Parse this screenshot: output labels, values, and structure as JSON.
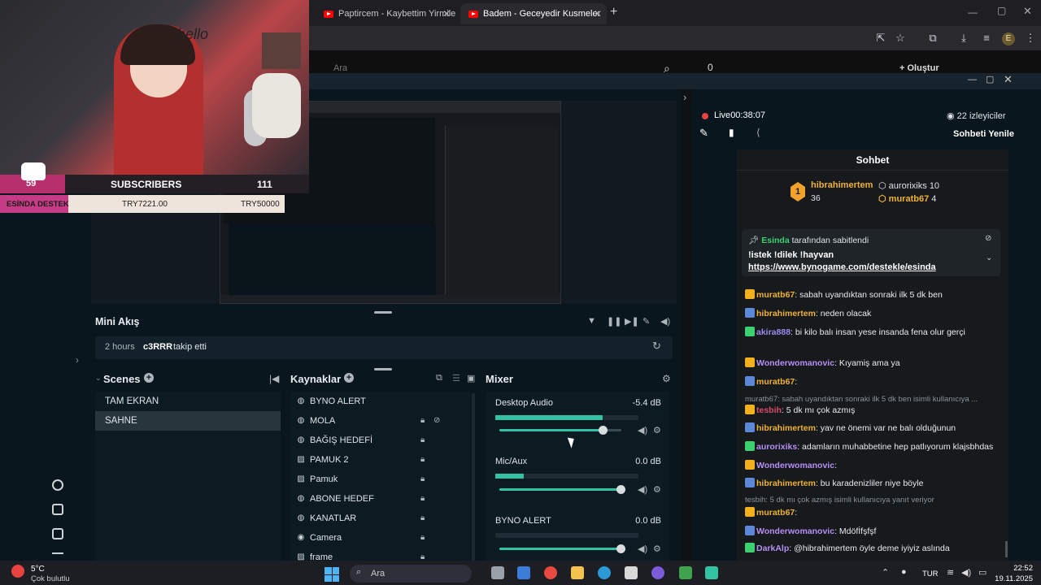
{
  "browser": {
    "tabs": [
      {
        "title": "Paptircem - Kaybettim Yirmiler"
      },
      {
        "title": "Badem - Geceyedir Kusmeler"
      }
    ],
    "new_tab": "+",
    "profile": "E"
  },
  "youtube": {
    "search_placeholder": "Ara",
    "notif_count": "0",
    "create_label": "Oluştur"
  },
  "overlay": {
    "subs_count_left": "59",
    "subs_label": "SUBSCRIBERS",
    "subs_count_right": "111",
    "donate_label": "ESİNDA DESTEK",
    "donate_current": "TRY7221.00",
    "donate_goal": "TRY50000"
  },
  "mini_feed": {
    "title": "Mini Akış",
    "event_time": "2 hours",
    "event_user": "c3RRR",
    "event_action": "takip etti"
  },
  "scenes": {
    "title": "Scenes",
    "items": [
      {
        "label": "TAM EKRAN",
        "selected": false
      },
      {
        "label": "SAHNE",
        "selected": true
      }
    ]
  },
  "sources": {
    "title": "Kaynaklar",
    "items": [
      {
        "label": "BYNO ALERT",
        "icon": "globe-icon"
      },
      {
        "label": "MOLA",
        "icon": "globe-icon"
      },
      {
        "label": "BAĞIŞ HEDEFİ",
        "icon": "globe-icon"
      },
      {
        "label": "PAMUK 2",
        "icon": "image-icon"
      },
      {
        "label": "Pamuk",
        "icon": "image-icon"
      },
      {
        "label": "ABONE HEDEF",
        "icon": "globe-icon"
      },
      {
        "label": "KANATLAR",
        "icon": "globe-icon"
      },
      {
        "label": "Camera",
        "icon": "camera-icon"
      },
      {
        "label": "frame",
        "icon": "image-icon"
      }
    ]
  },
  "mixer": {
    "title": "Mixer",
    "channels": [
      {
        "label": "Desktop Audio",
        "db": "-5.4 dB",
        "level": 0.75,
        "volume": 0.85
      },
      {
        "label": "Mic/Aux",
        "db": "0.0 dB",
        "level": 0.2,
        "volume": 1.0
      },
      {
        "label": "BYNO ALERT",
        "db": "0.0 dB",
        "level": 0.0,
        "volume": 1.0
      }
    ]
  },
  "live": {
    "status": "Live",
    "time": "00:38:07",
    "viewers": "22 izleyiciler",
    "refresh_chat": "Sohbeti Yenile"
  },
  "chat": {
    "title": "Sohbet",
    "top_user": "hibrahimertem",
    "top_user_score": "36",
    "top2_user": "aurorixiks",
    "top2_score": "10",
    "top3_user": "muratb67",
    "top3_score": "4",
    "pinned_by": "Esinda",
    "pinned_suffix": "tarafından sabitlendi",
    "pinned_text": "!istek !dilek !hayvan",
    "pinned_link": "https://www.bynogame.com/destekle/esinda",
    "messages": [
      {
        "user": "muratb67",
        "text": ": sabah uyandıktan sonraki ilk 5 dk ben",
        "color": "#f0b132"
      },
      {
        "user": "hibrahimertem",
        "text": ": neden olacak",
        "color": "#f0b132"
      },
      {
        "user": "akira888",
        "text": ": bi kilo balı insan yese insanda fena olur gerçi",
        "color": "#9b8cf0"
      },
      {
        "user": "Wonderwomanovic",
        "text": ": Kıyamiş ama ya",
        "color": "#b78ef5"
      },
      {
        "user": "muratb67",
        "text": ":",
        "color": "#f0b132"
      },
      {
        "reply": "muratb67: sabah uyandıktan sonraki ilk 5 dk ben isimli kullanıcıya ..."
      },
      {
        "user": "tesbih",
        "text": ": 5 dk mı çok azmış",
        "color": "#d84b6a"
      },
      {
        "user": "hibrahimertem",
        "text": ": yav ne önemi var ne balı olduğunun",
        "color": "#f0b132"
      },
      {
        "user": "aurorixiks",
        "text": ": adamların muhabbetine hep patlıyorum klajsbhdas",
        "color": "#b78ef5"
      },
      {
        "user": "Wonderwomanovic",
        "text": ":",
        "color": "#b78ef5"
      },
      {
        "user": "hibrahimertem",
        "text": ": bu karadenizliler niye böyle",
        "color": "#f0b132"
      },
      {
        "reply": "tesbih: 5 dk mı çok azmış isimli kullanıcıya yanıt veriyor"
      },
      {
        "user": "muratb67",
        "text": ":",
        "color": "#f0b132"
      },
      {
        "user": "Wonderwomanovic",
        "text": ": Mdöfİfşfşf",
        "color": "#b78ef5"
      },
      {
        "user": "DarkAlp",
        "text": ": @hibrahimertem öyle deme iyiyiz aslında",
        "color": "#b78ef5"
      }
    ]
  },
  "taskbar": {
    "weather_temp": "5°C",
    "weather_desc": "Çok bulutlu",
    "search": "Ara",
    "lang": "TUR",
    "time": "22:52",
    "date": "19.11.2025"
  }
}
